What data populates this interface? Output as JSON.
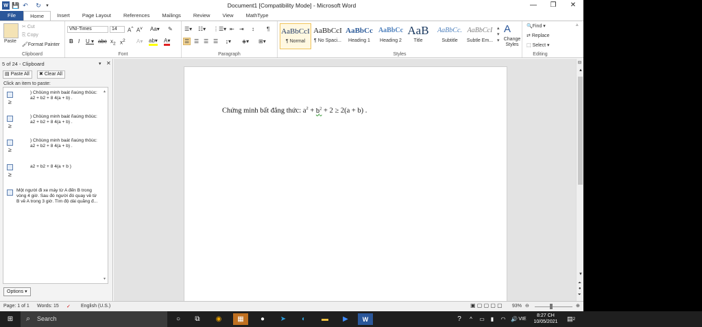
{
  "window": {
    "title": "Document1 [Compatibility Mode]  -  Microsoft Word",
    "controls": {
      "minimize": "—",
      "restore": "❐",
      "close": "✕"
    }
  },
  "tabs": [
    "File",
    "Home",
    "Insert",
    "Page Layout",
    "References",
    "Mailings",
    "Review",
    "View",
    "MathType"
  ],
  "active_tab": "Home",
  "ribbon": {
    "clipboard": {
      "paste": "Paste",
      "cut": "Cut",
      "copy": "Copy",
      "format_painter": "Format Painter",
      "label": "Clipboard"
    },
    "font": {
      "name": "VNI-Times",
      "size": "14",
      "label": "Font"
    },
    "paragraph": {
      "label": "Paragraph"
    },
    "styles": {
      "items": [
        {
          "preview": "AaBbCcI",
          "name": "¶ Normal"
        },
        {
          "preview": "AaBbCcI",
          "name": "¶ No Spaci..."
        },
        {
          "preview": "AaBbCc",
          "name": "Heading 1"
        },
        {
          "preview": "AaBbCc",
          "name": "Heading 2"
        },
        {
          "preview": "AaB",
          "name": "Title"
        },
        {
          "preview": "AaBbCc.",
          "name": "Subtitle"
        },
        {
          "preview": "AaBbCcI",
          "name": "Subtle Em..."
        }
      ],
      "change_styles": "Change Styles",
      "label": "Styles"
    },
    "editing": {
      "find": "Find",
      "replace": "Replace",
      "select": "Select",
      "label": "Editing"
    }
  },
  "pane": {
    "title": "5 of 24 - Clipboard",
    "paste_all": "Paste All",
    "clear_all": "Clear All",
    "hint": "Click an item to paste:",
    "items": [
      {
        "line1": ") Chöùng minh baát ñaúng thöùc:",
        "line2": "a2 + b2 + 8 4(a + b) ."
      },
      {
        "line1": ") Chöùng minh baát ñaúng thöùc:",
        "line2": "a2 + b2 + 8 4(a + b) ."
      },
      {
        "line1": ") Chöùng minh baát ñaúng thöùc:",
        "line2": "a2 + b2 + 8 4(a + b) ."
      },
      {
        "line1": "a2 + b2 + 8 4(a + b )",
        "line2": ""
      },
      {
        "line1": "Một người đi xe máy từ A đến B trong",
        "line2": "vòng 4 giờ. Sau đó người đó quay về từ",
        "line3": "B về A trong 3 giờ. Tìm độ dài quãng đ..."
      }
    ],
    "options": "Options"
  },
  "document": {
    "lead": "Chứng minh bất đẳng thức: a",
    "sup1": "2",
    "mid1": " + ",
    "b": "b",
    "sup2": "2",
    "mid2": " + 2 ≥ 2(a + b) ."
  },
  "status": {
    "page": "Page: 1 of 1",
    "words": "Words: 15",
    "language": "English (U.S.)",
    "zoom": "93%"
  },
  "taskbar": {
    "search": "Search",
    "lang": "VIE",
    "time": "8:27 CH",
    "date": "10/05/2021",
    "notification_count": "2"
  },
  "colors": {
    "accent": "#2b579a",
    "taskbar": "#1f1f1f"
  }
}
